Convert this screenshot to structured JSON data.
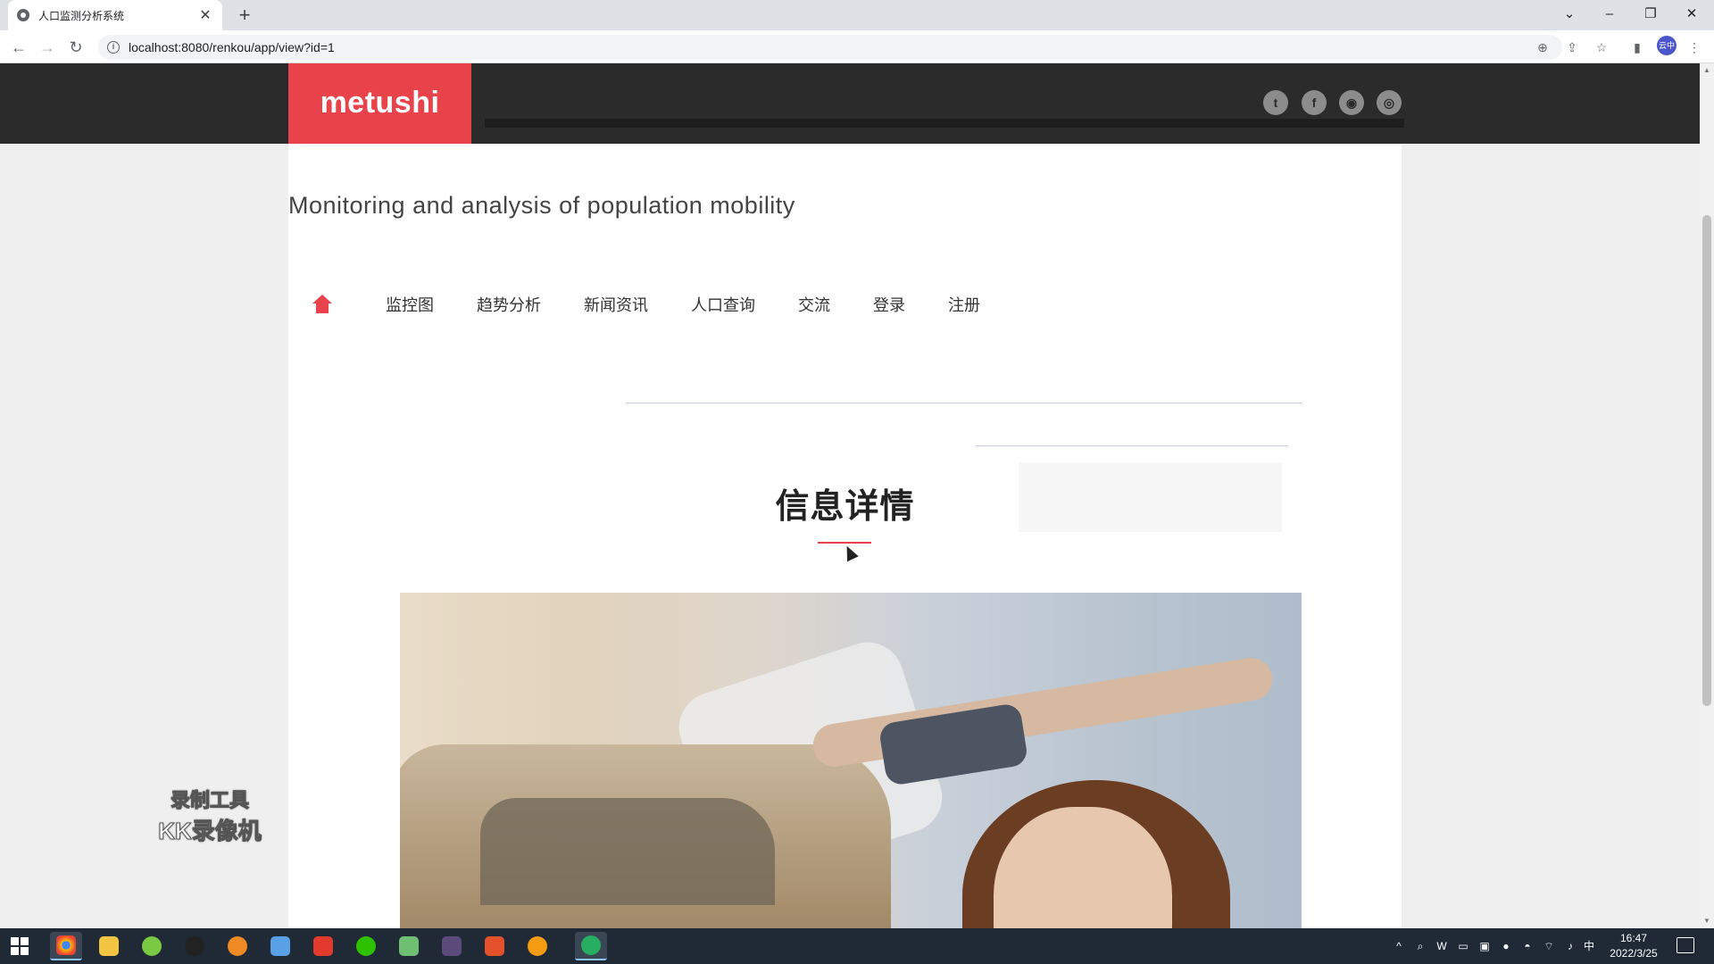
{
  "browser": {
    "tab_title": "人口监测分析系统",
    "tab_close": "✕",
    "new_tab": "+",
    "url": "localhost:8080/renkou/app/view?id=1",
    "back": "←",
    "forward": "→",
    "reload": "↻",
    "profile_label": "云中"
  },
  "site": {
    "logo": "metushi",
    "subtitle": "Monitoring and analysis of population mobility",
    "social_icons": [
      "twitter-icon",
      "facebook-icon",
      "chat-icon",
      "user-icon"
    ],
    "menu": [
      "监控图",
      "趋势分析",
      "新闻资讯",
      "人口查询",
      "交流",
      "登录",
      "注册"
    ],
    "detail_title": "信息详情"
  },
  "watermark": {
    "line1": "录制工具",
    "line2": "KK录像机"
  },
  "taskbar": {
    "tray_ime": "中",
    "time": "16:47",
    "date": "2022/3/25"
  }
}
